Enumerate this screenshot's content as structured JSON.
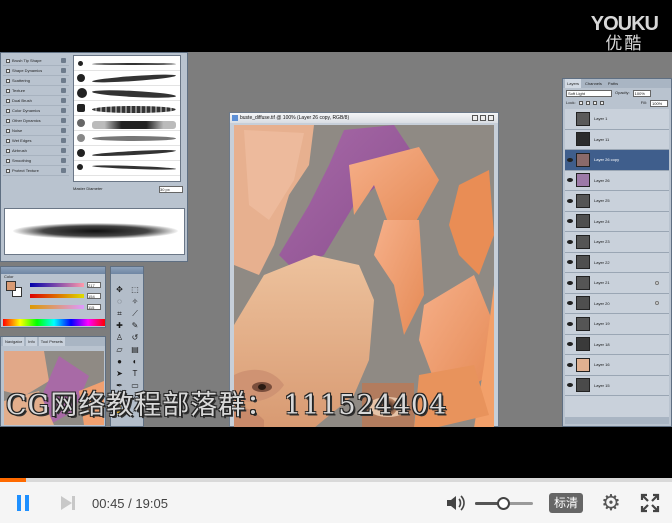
{
  "watermark": {
    "youku_en": "YOUKU",
    "youku_cn": "优酷",
    "overlay_text": "CG网络教程部落群： 111524404"
  },
  "brushes_panel": {
    "options": [
      "Brush Tip Shape",
      "Shape Dynamics",
      "Scattering",
      "Texture",
      "Dual Brush",
      "Color Dynamics",
      "Other Dynamics",
      "Noise",
      "Wet Edges",
      "Airbrush",
      "Smoothing",
      "Protect Texture"
    ],
    "master_label": "Master Diameter",
    "master_value": "30 px"
  },
  "color_panel": {
    "title": "Color",
    "r": "217",
    "g": "154",
    "b": "115",
    "fg_color": "#d99a73"
  },
  "navigator": {
    "tabs": [
      "Navigator",
      "Info",
      "Tool Presets"
    ]
  },
  "document": {
    "title": "buste_diffuse.tif @ 100% (Layer 26 copy, RGB/8)"
  },
  "layers_panel": {
    "tabs": [
      "Layers",
      "Channels",
      "Paths"
    ],
    "blend_mode": "Soft Light",
    "opacity_label": "Opacity:",
    "opacity_value": "100%",
    "lock_label": "Lock:",
    "fill_label": "Fill:",
    "fill_value": "100%",
    "layers": [
      {
        "name": "Layer 1",
        "visible": false,
        "selected": false,
        "thumb": "#5a5a5a"
      },
      {
        "name": "Layer 11",
        "visible": false,
        "selected": false,
        "thumb": "#2c2c2c"
      },
      {
        "name": "Layer 26 copy",
        "visible": true,
        "selected": true,
        "thumb": "#8a6a6a"
      },
      {
        "name": "Layer 26",
        "visible": true,
        "selected": false,
        "thumb": "#9d7aa8"
      },
      {
        "name": "Layer 25",
        "visible": true,
        "selected": false,
        "thumb": "#555555"
      },
      {
        "name": "Layer 24",
        "visible": true,
        "selected": false,
        "thumb": "#4f4f4f"
      },
      {
        "name": "Layer 23",
        "visible": true,
        "selected": false,
        "thumb": "#555555"
      },
      {
        "name": "Layer 22",
        "visible": true,
        "selected": false,
        "thumb": "#4f4f4f"
      },
      {
        "name": "Layer 21",
        "visible": true,
        "selected": false,
        "thumb": "#555555"
      },
      {
        "name": "Layer 20",
        "visible": true,
        "selected": false,
        "thumb": "#4f4f4f"
      },
      {
        "name": "Layer 19",
        "visible": true,
        "selected": false,
        "thumb": "#555555"
      },
      {
        "name": "Layer 18",
        "visible": true,
        "selected": false,
        "thumb": "#3a3a3a"
      },
      {
        "name": "Layer 16",
        "visible": true,
        "selected": false,
        "thumb": "#e0b090"
      },
      {
        "name": "Layer 15",
        "visible": true,
        "selected": false,
        "thumb": "#4a4a4a"
      }
    ]
  },
  "player": {
    "current_time": "00:45",
    "separator": " / ",
    "duration": "19:05",
    "progress_fraction": 0.039,
    "volume_fraction": 0.5,
    "quality_label": "标清",
    "accent_color": "#1e90ff",
    "progress_color": "#ff6a00",
    "icons": [
      "pause-icon",
      "next-icon",
      "volume-icon",
      "gear-icon",
      "fullscreen-icon"
    ]
  }
}
